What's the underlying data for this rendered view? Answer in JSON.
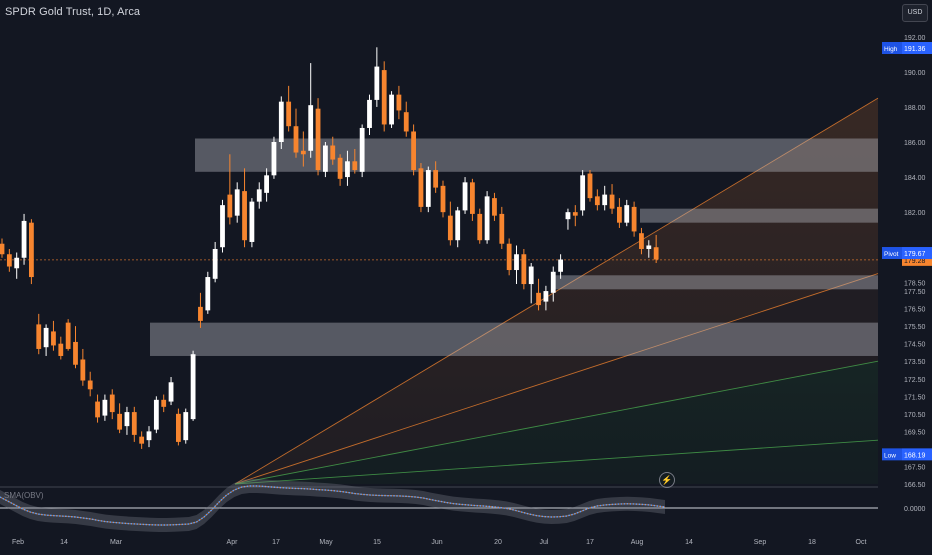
{
  "header": {
    "title": "SPDR Gold Trust, 1D, Arca",
    "currency": "USD"
  },
  "indicator": {
    "label": "SMA(OBV)",
    "zero_label": "0.0000"
  },
  "icons": {
    "lightning": "lightning-icon"
  },
  "colors": {
    "background": "#131722",
    "up": "#ffffff",
    "down": "#f7852f",
    "zone": "#b2b5be",
    "fib": "#f7852f",
    "price_line": "#f7852f",
    "axis_text": "#b2b5be"
  },
  "chart_data": {
    "type": "candlestick",
    "title": "SPDR Gold Trust, 1D, Arca",
    "ylim": [
      166.5,
      192.5
    ],
    "y_ticks": [
      192.0,
      191.0,
      190.0,
      189.0,
      188.0,
      187.0,
      186.0,
      185.0,
      184.0,
      183.0,
      182.0,
      181.0,
      180.0,
      179.0,
      178.0,
      177.5,
      176.5,
      175.5,
      174.5,
      173.5,
      172.5,
      171.5,
      170.5,
      169.5,
      168.5,
      167.5,
      166.5
    ],
    "y_tick_labels": [
      "192.00",
      "",
      "190.00",
      "",
      "188.00",
      "",
      "186.00",
      "",
      "184.00",
      "",
      "182.00",
      "",
      "",
      "",
      "178.50",
      "177.50",
      "176.50",
      "175.50",
      "174.50",
      "173.50",
      "172.50",
      "171.50",
      "170.50",
      "169.50",
      "",
      "167.50",
      "166.50"
    ],
    "x_labels": [
      "Feb",
      "14",
      "Mar",
      "Apr",
      "17",
      "May",
      "15",
      "Jun",
      "20",
      "Jul",
      "17",
      "Aug",
      "14",
      "Sep",
      "18",
      "Oct"
    ],
    "price_labels": [
      {
        "label": "High",
        "value": "191.36",
        "price": 191.36
      },
      {
        "label": "",
        "value": "179.28",
        "price": 179.28
      },
      {
        "label": "Pivot",
        "value": "179.67",
        "price": 179.67
      },
      {
        "label": "Low",
        "value": "168.19",
        "price": 168.19
      }
    ],
    "last_price": 179.28,
    "zones": [
      {
        "top": 186.2,
        "bottom": 184.3
      },
      {
        "top": 182.2,
        "bottom": 181.4
      },
      {
        "top": 178.4,
        "bottom": 177.6
      },
      {
        "top": 175.7,
        "bottom": 173.8
      }
    ],
    "fan": {
      "origin": {
        "x": "Mar 22",
        "price": 166.5
      },
      "lines": [
        {
          "end_price": 188.5,
          "color": "#f7852f"
        },
        {
          "end_price": 178.5,
          "color": "#f7852f"
        },
        {
          "end_price": 173.5,
          "color": "#4caf50"
        },
        {
          "end_price": 169.0,
          "color": "#4caf50"
        }
      ]
    },
    "candles": [
      [
        180.2,
        180.5,
        179.4,
        179.6
      ],
      [
        179.6,
        179.9,
        178.6,
        178.9
      ],
      [
        178.8,
        179.7,
        178.2,
        179.4
      ],
      [
        179.4,
        181.9,
        179.0,
        181.5
      ],
      [
        181.4,
        181.6,
        177.9,
        178.3
      ],
      [
        175.6,
        176.2,
        173.9,
        174.2
      ],
      [
        174.3,
        175.6,
        173.8,
        175.4
      ],
      [
        175.2,
        175.8,
        174.1,
        174.4
      ],
      [
        174.5,
        174.9,
        173.6,
        173.8
      ],
      [
        175.7,
        175.9,
        174.1,
        174.2
      ],
      [
        174.6,
        175.5,
        173.1,
        173.3
      ],
      [
        173.6,
        174.2,
        172.1,
        172.4
      ],
      [
        172.4,
        172.9,
        171.5,
        171.9
      ],
      [
        171.2,
        171.6,
        170.0,
        170.3
      ],
      [
        170.4,
        171.6,
        170.1,
        171.3
      ],
      [
        171.6,
        171.9,
        170.2,
        170.6
      ],
      [
        170.5,
        171.1,
        169.4,
        169.6
      ],
      [
        169.8,
        170.9,
        169.3,
        170.6
      ],
      [
        170.6,
        170.9,
        168.9,
        169.3
      ],
      [
        169.2,
        169.5,
        168.5,
        168.8
      ],
      [
        169.0,
        169.8,
        168.6,
        169.5
      ],
      [
        169.6,
        171.5,
        169.4,
        171.3
      ],
      [
        171.3,
        171.6,
        170.6,
        170.9
      ],
      [
        171.2,
        172.6,
        171.0,
        172.3
      ],
      [
        170.5,
        170.8,
        168.7,
        168.9
      ],
      [
        169.0,
        170.8,
        168.8,
        170.6
      ],
      [
        170.2,
        174.1,
        170.1,
        173.9
      ],
      [
        176.6,
        177.4,
        175.4,
        175.8
      ],
      [
        176.4,
        178.6,
        176.2,
        178.3
      ],
      [
        178.2,
        180.3,
        178.0,
        179.9
      ],
      [
        180.0,
        182.7,
        179.7,
        182.4
      ],
      [
        183.0,
        185.3,
        181.3,
        181.7
      ],
      [
        181.8,
        183.7,
        181.4,
        183.3
      ],
      [
        183.2,
        184.5,
        180.0,
        180.4
      ],
      [
        180.3,
        182.8,
        180.0,
        182.6
      ],
      [
        182.6,
        183.7,
        182.2,
        183.3
      ],
      [
        183.1,
        184.5,
        182.6,
        184.1
      ],
      [
        184.1,
        186.3,
        183.9,
        186.0
      ],
      [
        186.0,
        188.6,
        185.6,
        188.3
      ],
      [
        188.3,
        189.2,
        186.6,
        186.9
      ],
      [
        186.9,
        187.9,
        185.1,
        185.4
      ],
      [
        185.5,
        186.6,
        184.6,
        185.3
      ],
      [
        185.5,
        190.5,
        185.1,
        188.1
      ],
      [
        187.9,
        188.5,
        184.1,
        184.4
      ],
      [
        184.3,
        186.0,
        184.0,
        185.8
      ],
      [
        185.8,
        186.3,
        184.7,
        185.0
      ],
      [
        185.1,
        185.3,
        183.5,
        183.9
      ],
      [
        184.0,
        185.5,
        183.5,
        184.9
      ],
      [
        184.9,
        185.6,
        184.2,
        184.4
      ],
      [
        184.3,
        187.0,
        184.0,
        186.8
      ],
      [
        186.8,
        188.7,
        186.4,
        188.4
      ],
      [
        188.4,
        191.4,
        188.0,
        190.3
      ],
      [
        190.1,
        190.6,
        186.6,
        187.0
      ],
      [
        187.0,
        188.9,
        186.8,
        188.7
      ],
      [
        188.7,
        189.2,
        187.3,
        187.8
      ],
      [
        187.7,
        188.3,
        186.3,
        186.6
      ],
      [
        186.6,
        187.0,
        184.1,
        184.4
      ],
      [
        184.5,
        184.8,
        182.0,
        182.3
      ],
      [
        182.3,
        184.6,
        182.0,
        184.4
      ],
      [
        184.4,
        184.9,
        183.1,
        183.4
      ],
      [
        183.5,
        183.8,
        181.7,
        182.0
      ],
      [
        181.8,
        182.6,
        180.1,
        180.4
      ],
      [
        180.4,
        182.3,
        180.0,
        182.1
      ],
      [
        182.1,
        184.0,
        181.9,
        183.7
      ],
      [
        183.7,
        183.9,
        181.5,
        181.9
      ],
      [
        181.9,
        182.2,
        180.2,
        180.4
      ],
      [
        180.4,
        183.2,
        180.2,
        182.9
      ],
      [
        182.8,
        183.1,
        181.5,
        181.8
      ],
      [
        181.9,
        182.3,
        179.9,
        180.2
      ],
      [
        180.2,
        180.5,
        178.4,
        178.7
      ],
      [
        178.7,
        180.1,
        177.9,
        179.6
      ],
      [
        179.6,
        179.9,
        177.6,
        177.9
      ],
      [
        177.9,
        179.1,
        176.8,
        178.9
      ],
      [
        177.4,
        178.2,
        176.4,
        176.7
      ],
      [
        176.9,
        177.8,
        176.4,
        177.5
      ],
      [
        177.4,
        178.9,
        176.9,
        178.6
      ],
      [
        178.6,
        179.6,
        178.2,
        179.3
      ],
      [
        181.6,
        182.2,
        181.0,
        182.0
      ],
      [
        182.0,
        182.4,
        181.2,
        181.8
      ],
      [
        182.1,
        184.4,
        181.8,
        184.1
      ],
      [
        184.2,
        184.4,
        182.6,
        182.8
      ],
      [
        182.9,
        183.3,
        182.1,
        182.4
      ],
      [
        182.4,
        183.5,
        182.1,
        183.0
      ],
      [
        183.0,
        183.6,
        181.9,
        182.2
      ],
      [
        182.3,
        182.8,
        181.1,
        181.4
      ],
      [
        181.4,
        182.7,
        181.2,
        182.4
      ],
      [
        182.3,
        182.6,
        180.6,
        180.9
      ],
      [
        180.8,
        181.1,
        179.6,
        179.9
      ],
      [
        179.9,
        180.4,
        179.4,
        180.1
      ],
      [
        180.0,
        180.7,
        179.1,
        179.3
      ]
    ],
    "indicator": {
      "name": "SMA(OBV)",
      "range": [
        -1.0,
        1.0
      ],
      "values": [
        0.55,
        0.35,
        0.15,
        -0.05,
        -0.2,
        -0.3,
        -0.35,
        -0.38,
        -0.4,
        -0.42,
        -0.45,
        -0.5,
        -0.55,
        -0.62,
        -0.68,
        -0.72,
        -0.75,
        -0.78,
        -0.8,
        -0.82,
        -0.84,
        -0.85,
        -0.85,
        -0.84,
        -0.82,
        -0.8,
        -0.7,
        -0.45,
        -0.1,
        0.3,
        0.65,
        0.9,
        1.05,
        1.1,
        1.1,
        1.08,
        1.05,
        1.02,
        1.0,
        0.98,
        0.97,
        0.95,
        0.92,
        0.9,
        0.87,
        0.83,
        0.78,
        0.72,
        0.68,
        0.65,
        0.63,
        0.62,
        0.61,
        0.6,
        0.58,
        0.55,
        0.5,
        0.42,
        0.35,
        0.28,
        0.22,
        0.18,
        0.15,
        0.12,
        0.1,
        0.07,
        0.03,
        -0.02,
        -0.1,
        -0.2,
        -0.3,
        -0.38,
        -0.43,
        -0.45,
        -0.44,
        -0.4,
        -0.3,
        -0.15,
        0.0,
        0.1,
        0.15,
        0.18,
        0.2,
        0.21,
        0.2,
        0.18,
        0.15,
        0.1,
        0.05
      ]
    }
  }
}
